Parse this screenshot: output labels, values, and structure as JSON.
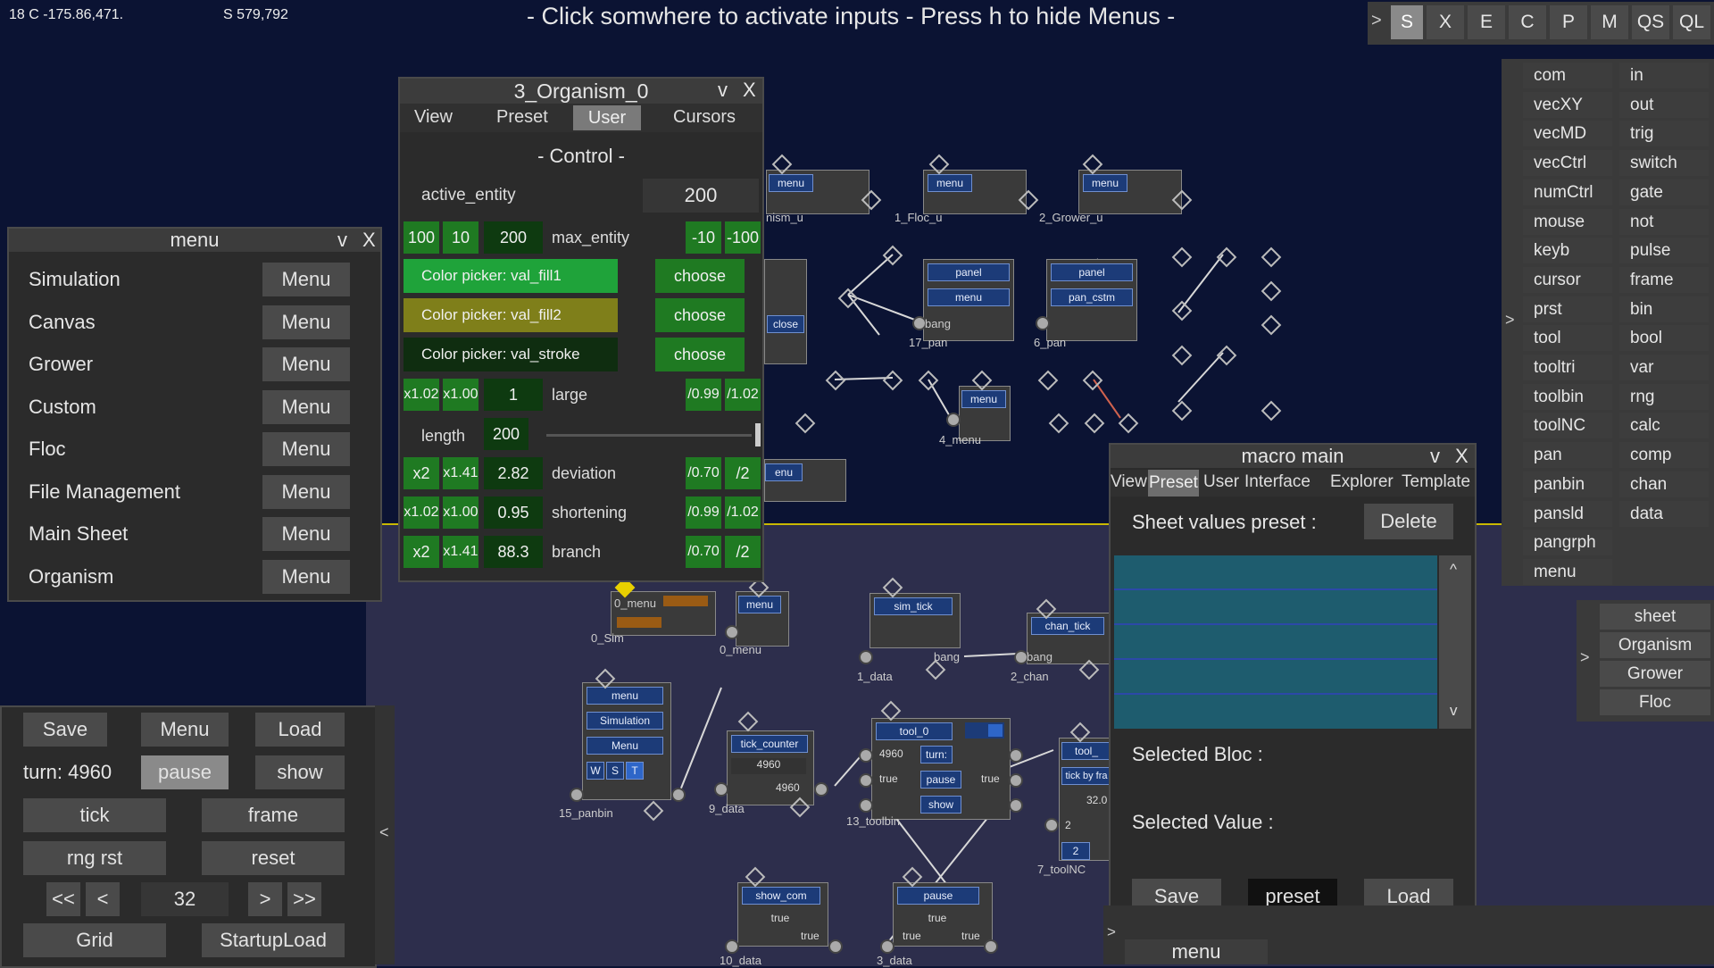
{
  "status": {
    "coords": "18 C -175.86,471.",
    "scale": "S 579,792",
    "hint": "-  Click somwhere to activate inputs  -  Press h to hide Menus  -"
  },
  "top_toolbar": {
    "arrow": ">",
    "buttons": [
      "S",
      "X",
      "E",
      "C",
      "P",
      "M",
      "QS",
      "QL"
    ]
  },
  "right_panel": {
    "arrow": ">",
    "col1": [
      "com",
      "vecXY",
      "vecMD",
      "vecCtrl",
      "numCtrl",
      "mouse",
      "keyb",
      "cursor",
      "prst",
      "tool",
      "tooltri",
      "toolbin",
      "toolNC",
      "pan",
      "panbin",
      "pansld",
      "pangrph",
      "menu"
    ],
    "col2": [
      "in",
      "out",
      "trig",
      "switch",
      "gate",
      "not",
      "pulse",
      "frame",
      "bin",
      "bool",
      "var",
      "rng",
      "calc",
      "comp",
      "chan",
      "data"
    ]
  },
  "sheet_panel": {
    "arrow": ">",
    "items": [
      "sheet",
      "Organism",
      "Grower",
      "Floc"
    ]
  },
  "menu_window": {
    "title": "menu",
    "v": "v",
    "x": "X",
    "rows": [
      {
        "label": "Simulation",
        "btn": "Menu"
      },
      {
        "label": "Canvas",
        "btn": "Menu"
      },
      {
        "label": "Grower",
        "btn": "Menu"
      },
      {
        "label": "Custom",
        "btn": "Menu"
      },
      {
        "label": "Floc",
        "btn": "Menu"
      },
      {
        "label": "File Management",
        "btn": "Menu"
      },
      {
        "label": "Main Sheet",
        "btn": "Menu"
      },
      {
        "label": "Organism",
        "btn": "Menu"
      }
    ]
  },
  "organism_window": {
    "title": "3_Organism_0",
    "v": "v",
    "x": "X",
    "tabs": [
      "View",
      "Preset",
      "User",
      "Cursors"
    ],
    "section": "-  Control  -",
    "active_entity_label": "active_entity",
    "active_entity_value": "200",
    "max_entity": {
      "b1": "100",
      "b2": "10",
      "val": "200",
      "label": "max_entity",
      "m1": "-10",
      "m2": "-100"
    },
    "pickers": [
      {
        "label": "Color picker: val_fill1",
        "btn": "choose",
        "color": "#1fa33a"
      },
      {
        "label": "Color picker: val_fill2",
        "btn": "choose",
        "color": "#7f7f1a"
      },
      {
        "label": "Color picker: val_stroke",
        "btn": "choose",
        "color": "#0f2d10"
      }
    ],
    "large": {
      "b1": "x1.02",
      "b2": "x1.00",
      "val": "1",
      "label": "large",
      "m1": "/0.99",
      "m2": "/1.02"
    },
    "length": {
      "label": "length",
      "val": "200"
    },
    "deviation": {
      "b1": "x2",
      "b2": "x1.41",
      "val": "2.82",
      "label": "deviation",
      "m1": "/0.70",
      "m2": "/2"
    },
    "shortening": {
      "b1": "x1.02",
      "b2": "x1.00",
      "val": "0.95",
      "label": "shortening",
      "m1": "/0.99",
      "m2": "/1.02"
    },
    "branch": {
      "b1": "x2",
      "b2": "x1.41",
      "val": "88.3",
      "label": "branch",
      "m1": "/0.70",
      "m2": "/2"
    }
  },
  "bottom_left": {
    "save": "Save",
    "menu": "Menu",
    "load": "Load",
    "turn": "turn: 4960",
    "pause": "pause",
    "show": "show",
    "tick": "tick",
    "frame": "frame",
    "rng_rst": "rng rst",
    "reset": "reset",
    "first": "<<",
    "prev": "<",
    "page": "32",
    "next": ">",
    "last": ">>",
    "grid": "Grid",
    "startup": "StartupLoad",
    "collapse": "<"
  },
  "macro_window": {
    "title": "macro main",
    "v": "v",
    "x": "X",
    "tabs": [
      "View",
      "Preset",
      "User",
      "Interface",
      "Explorer",
      "Template"
    ],
    "sheet_values_label": "Sheet values preset :",
    "delete": "Delete",
    "scroll_up": "^",
    "scroll_down": "v",
    "selected_bloc": "Selected Bloc :",
    "selected_value": "Selected Value :",
    "save": "Save",
    "preset": "preset",
    "load": "Load"
  },
  "bottom_bar": {
    "arrow": ">",
    "menu": "menu"
  },
  "nodes": {
    "organism_u": "nism_u",
    "floc_u": "1_Floc_u",
    "grower_u": "2_Grower_u",
    "menu_lbl": "menu",
    "panel": "panel",
    "pan_cstm": "pan_cstm",
    "close": "close",
    "bang": "bang",
    "p17": "17_pan",
    "p6": "6_pan",
    "menu4": "4_menu",
    "enu": "enu",
    "o_menu": "0_menu",
    "o_sim": "0_Sim",
    "o_menu2": "0_menu",
    "sim_tick": "sim_tick",
    "data1": "1_data",
    "chan_tick": "chan_tick",
    "chan2": "2_chan",
    "simulation": "Simulation",
    "Menu": "Menu",
    "w": "W",
    "s": "S",
    "t": "T",
    "panbin15": "15_panbin",
    "tick_counter": "tick_counter",
    "v4960": "4960",
    "data9": "9_data",
    "tool_0": "tool_0",
    "turn": "turn:",
    "pause": "pause",
    "true": "true",
    "show": "show",
    "toolbin13": "13_toolbin",
    "tool_": "tool_",
    "tick_by": "tick by fra",
    "v32": "32.0",
    "v2": "2",
    "toolnc7": "7_toolNC",
    "show_com": "show_com",
    "data10": "10_data",
    "data3": "3_data"
  }
}
